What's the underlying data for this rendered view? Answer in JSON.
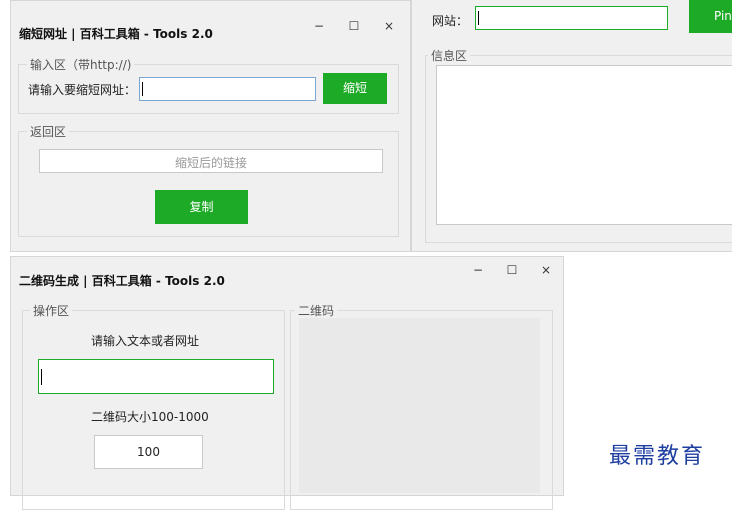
{
  "shorten_window": {
    "title": "缩短网址 | 百科工具箱 - Tools 2.0",
    "minimize": "−",
    "maximize": "☐",
    "close": "×",
    "input_group_label": "输入区（带http://)",
    "input_prompt": "请输入要缩短网址：",
    "input_value": "",
    "shorten_button": "缩短",
    "output_group_label": "返回区",
    "output_placeholder": "缩短后的链接",
    "copy_button": "复制"
  },
  "ping_window": {
    "site_label": "网站：",
    "site_value": "",
    "ping_button": "Pin",
    "info_group_label": "信息区"
  },
  "qr_window": {
    "title": "二维码生成 | 百科工具箱 - Tools 2.0",
    "minimize": "−",
    "maximize": "☐",
    "close": "×",
    "operation_group_label": "操作区",
    "text_prompt": "请输入文本或者网址",
    "text_value": "",
    "size_label": "二维码大小100-1000",
    "size_value": "100",
    "qr_group_label": "二维码"
  },
  "watermark": "最需教育"
}
